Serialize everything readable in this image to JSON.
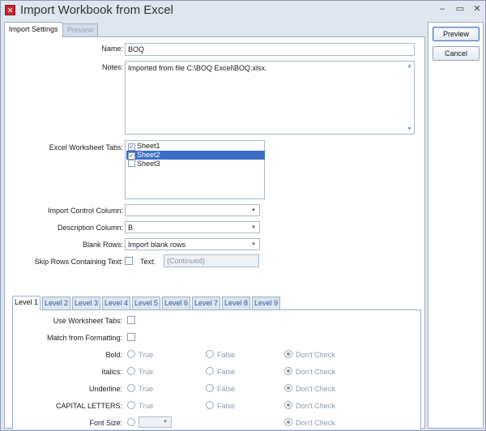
{
  "window": {
    "title": "Import Workbook from Excel",
    "min_glyph": "–",
    "max_glyph": "▭",
    "close_glyph": "✕"
  },
  "tabs": {
    "import_settings": "Import Settings",
    "preview": "Preview"
  },
  "form": {
    "name_label": "Name:",
    "name_value": "BOQ",
    "notes_label": "Notes:",
    "notes_value": "Imported from file C:\\BOQ Excel\\BOQ.xlsx.",
    "worksheet_tabs_label": "Excel Worksheet Tabs:",
    "worksheets": [
      {
        "name": "Sheet1",
        "checked": true,
        "selected": false
      },
      {
        "name": "Sheet2",
        "checked": true,
        "selected": true
      },
      {
        "name": "Sheet3",
        "checked": false,
        "selected": false
      }
    ],
    "import_control_label": "Import Control Column:",
    "import_control_value": "",
    "description_label": "Description Column:",
    "description_value": "B",
    "blank_rows_label": "Blank Rows:",
    "blank_rows_value": "Import blank rows",
    "skip_rows_label": "Skip Rows Containing Text:",
    "text_label": "Text:",
    "text_value": "(Continued)"
  },
  "levels": {
    "tabs": [
      "Level 1",
      "Level 2",
      "Level 3",
      "Level 4",
      "Level 5",
      "Level 6",
      "Level 7",
      "Level 8",
      "Level 9"
    ],
    "active_tab": "Level 1",
    "use_worksheet_tabs_label": "Use Worksheet Tabs:",
    "match_formatting_label": "Match from Formatting:",
    "option_true": "True",
    "option_false": "False",
    "option_dont_check": "Don't Check",
    "rows": [
      {
        "label": "Bold:",
        "selected": "Don't Check"
      },
      {
        "label": "Italics:",
        "selected": "Don't Check"
      },
      {
        "label": "Underline:",
        "selected": "Don't Check"
      },
      {
        "label": "CAPITAL LETTERS:",
        "selected": "Don't Check"
      }
    ],
    "font_size_label": "Font Size:",
    "font_size_selected": "Don't Check"
  },
  "buttons": {
    "preview": "Preview",
    "cancel": "Cancel"
  },
  "colors": {
    "selection": "#3b6fc7",
    "level_tab_text": "#2b5aa8",
    "window_bg": "#dfe6ef"
  }
}
